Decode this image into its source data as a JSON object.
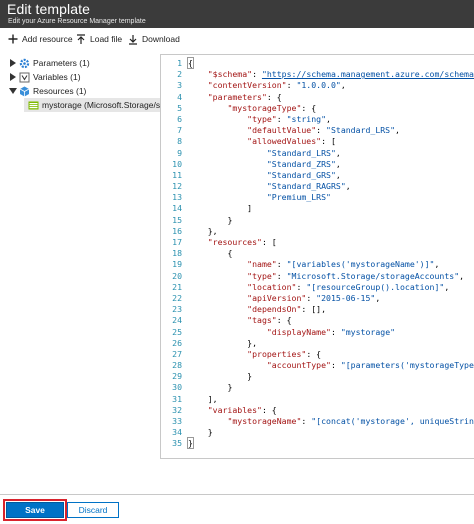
{
  "header": {
    "title": "Edit template",
    "subtitle": "Edit your Azure Resource Manager template"
  },
  "toolbar": {
    "add_resource": "Add resource",
    "load_file": "Load file",
    "download": "Download"
  },
  "tree": {
    "parameters": "Parameters (1)",
    "variables": "Variables (1)",
    "resources": "Resources (1)",
    "resource_item": "mystorage (Microsoft.Storage/stor..."
  },
  "editor": {
    "line_numbers": [
      "1",
      "2",
      "3",
      "4",
      "5",
      "6",
      "7",
      "8",
      "9",
      "10",
      "11",
      "12",
      "13",
      "14",
      "15",
      "16",
      "17",
      "18",
      "19",
      "20",
      "21",
      "22",
      "23",
      "24",
      "25",
      "26",
      "27",
      "28",
      "29",
      "30",
      "31",
      "32",
      "33",
      "34",
      "35"
    ]
  },
  "footer": {
    "save_label": "Save",
    "discard_label": "Discard"
  },
  "colors": {
    "header_bg": "#3b3b3b",
    "primary": "#0072c6",
    "highlight_outline": "#d9232d",
    "json_key": "#a31515",
    "json_string": "#0451a5",
    "line_number": "#2b91af"
  }
}
